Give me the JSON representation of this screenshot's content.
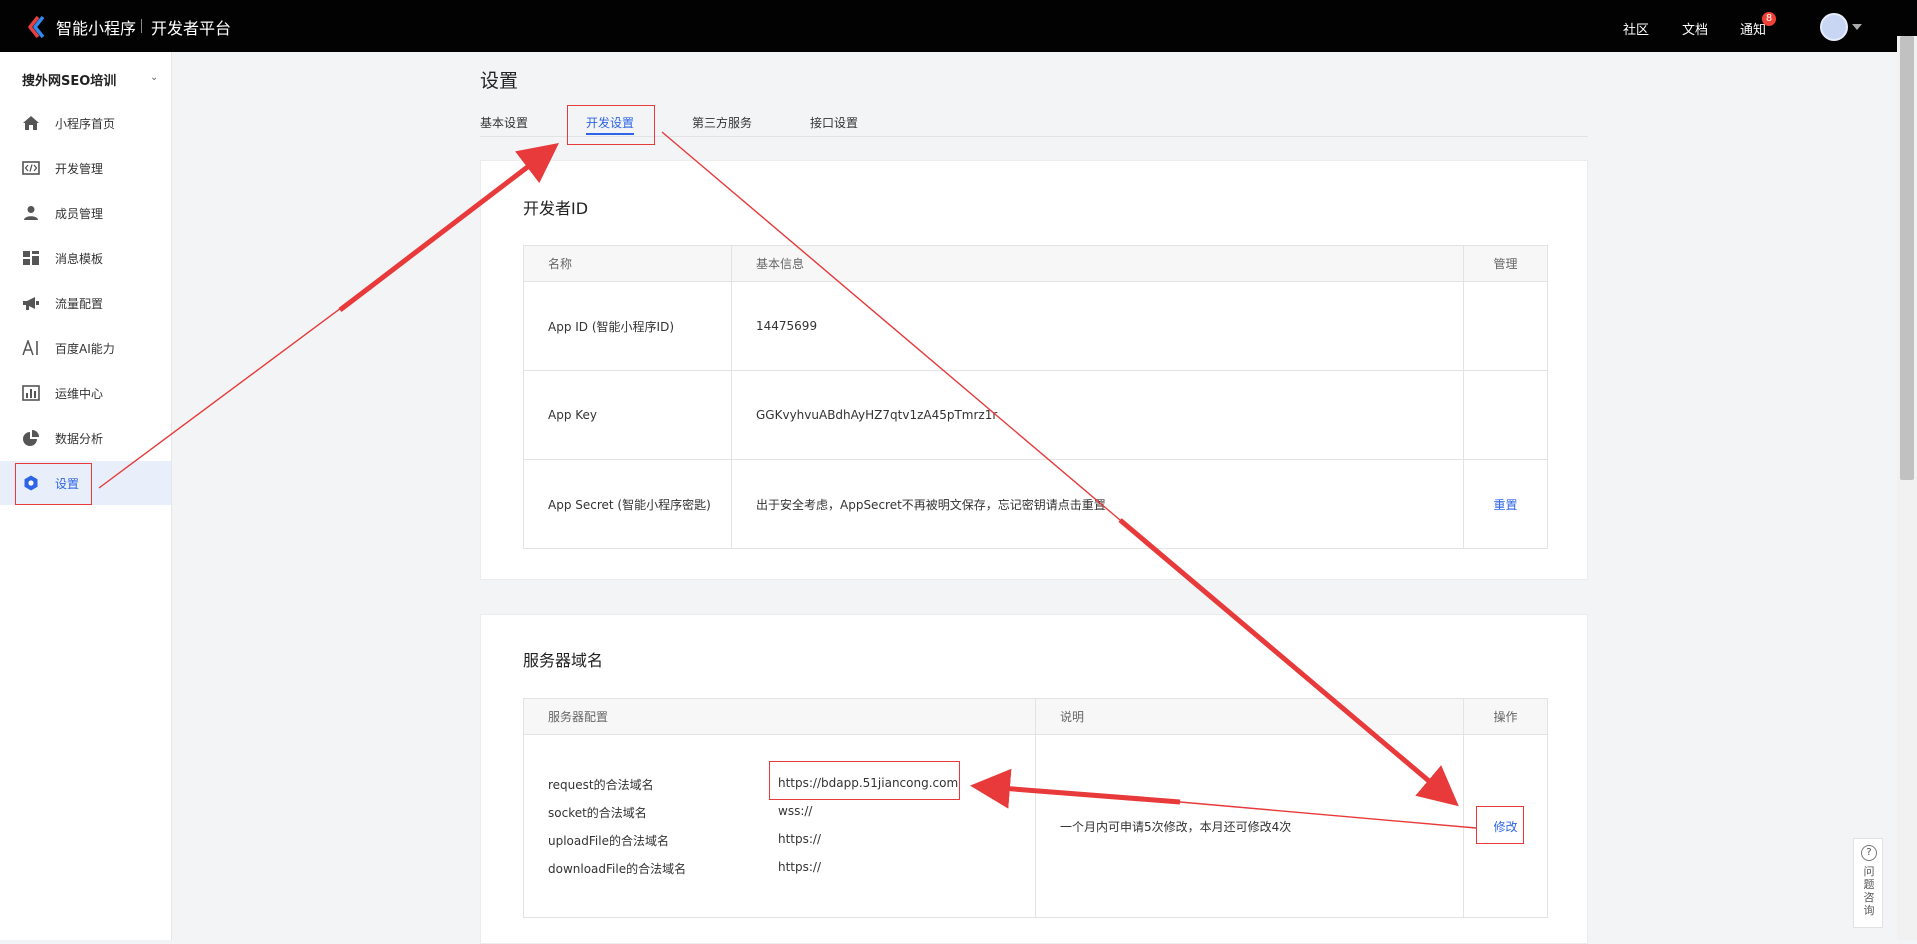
{
  "topbar": {
    "brand": "智能小程序",
    "brand_sub": "开发者平台",
    "links": [
      "社区",
      "文档",
      "通知"
    ],
    "notification_count": "8"
  },
  "sidebar": {
    "account_name": "搜外网SEO培训",
    "items": [
      {
        "label": "小程序首页",
        "icon": "home-icon"
      },
      {
        "label": "开发管理",
        "icon": "code-icon"
      },
      {
        "label": "成员管理",
        "icon": "user-icon"
      },
      {
        "label": "消息模板",
        "icon": "grid-icon"
      },
      {
        "label": "流量配置",
        "icon": "megaphone-icon"
      },
      {
        "label": "百度AI能力",
        "icon": "ai-icon"
      },
      {
        "label": "运维中心",
        "icon": "chart-icon"
      },
      {
        "label": "数据分析",
        "icon": "pie-icon"
      },
      {
        "label": "设置",
        "icon": "gear-icon"
      }
    ],
    "active_index": 8
  },
  "main": {
    "title": "设置",
    "tabs": [
      "基本设置",
      "开发设置",
      "第三方服务",
      "接口设置"
    ],
    "active_tab": 1,
    "developer_id": {
      "title": "开发者ID",
      "headers": [
        "名称",
        "基本信息",
        "管理"
      ],
      "rows": [
        {
          "name": "App ID (智能小程序ID)",
          "info": "14475699",
          "action": ""
        },
        {
          "name": "App Key",
          "info": "GGKvyhvuABdhAyHZ7qtv1zA45pTmrz1r",
          "action": ""
        },
        {
          "name": "App Secret (智能小程序密匙)",
          "info": "出于安全考虑，AppSecret不再被明文保存，忘记密钥请点击重置",
          "action": "重置"
        }
      ]
    },
    "server_domain": {
      "title": "服务器域名",
      "headers": [
        "服务器配置",
        "说明",
        "操作"
      ],
      "entries": [
        {
          "key": "request的合法域名",
          "value": "https://bdapp.51jiancong.com"
        },
        {
          "key": "socket的合法域名",
          "value": "wss://"
        },
        {
          "key": "uploadFile的合法域名",
          "value": "https://"
        },
        {
          "key": "downloadFile的合法域名",
          "value": "https://"
        }
      ],
      "note": "一个月内可申请5次修改，本月还可修改4次",
      "action": "修改"
    }
  },
  "help": {
    "label": "问题咨询"
  },
  "colors": {
    "accent": "#2e65e6",
    "annotation": "#e83a3a",
    "topbar": "#020202"
  }
}
